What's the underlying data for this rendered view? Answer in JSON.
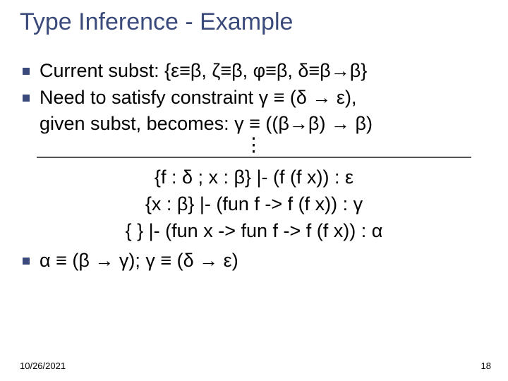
{
  "title": "Type Inference - Example",
  "bullets": {
    "b1": "Current subst: {ε≡β, ζ≡β, φ≡β, δ≡β→β}",
    "b2a": "Need to satisfy constraint γ ≡ (δ → ε),",
    "b2b": "given subst, becomes: γ ≡ ((β→β) → β)"
  },
  "vdots": "⋮",
  "deriv": {
    "d1": "{f : δ ; x : β} |- (f (f x)) : ε",
    "d2": "{x : β} |- (fun f -> f (f x)) : γ",
    "d3": "{ } |- (fun x -> fun f -> f (f x)) : α"
  },
  "constraints": "α ≡ (β → γ); γ ≡ (δ → ε)",
  "footer": {
    "date": "10/26/2021",
    "page": "18"
  }
}
